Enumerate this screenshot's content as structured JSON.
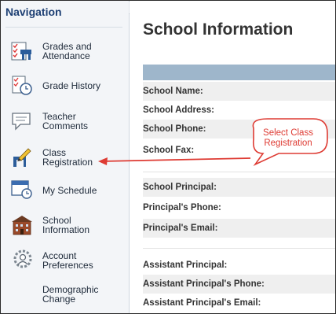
{
  "sidebar": {
    "heading": "Navigation",
    "items": [
      {
        "label": "Grades and\nAttendance",
        "icon": "gradebook-icon"
      },
      {
        "label": "Grade History",
        "icon": "grade-history-icon"
      },
      {
        "label": "Teacher\nComments",
        "icon": "comments-icon"
      },
      {
        "label": "Class\nRegistration",
        "icon": "pencil-icon"
      },
      {
        "label": "My Schedule",
        "icon": "schedule-icon"
      },
      {
        "label": "School\nInformation",
        "icon": "school-building-icon"
      },
      {
        "label": "Account\nPreferences",
        "icon": "account-preferences-icon"
      },
      {
        "label": "Demographic\nChange",
        "icon": ""
      }
    ]
  },
  "main": {
    "title": "School Information",
    "rows": {
      "school_name": "School Name:",
      "school_address": "School Address:",
      "school_phone": "School Phone:",
      "school_fax": "School Fax:",
      "principal": "School Principal:",
      "principal_phone": "Principal's Phone:",
      "principal_email": "Principal's Email:",
      "assistant_principal": "Assistant Principal:",
      "assistant_phone": "Assistant Principal's Phone:",
      "assistant_email": "Assistant Principal's Email:"
    }
  },
  "annotation": {
    "text": "Select Class\nRegistration",
    "color": "#de3b33"
  },
  "colors": {
    "nav_heading": "#1d3f73",
    "table_header": "#9eb6cb",
    "row_shade": "#efefef"
  }
}
